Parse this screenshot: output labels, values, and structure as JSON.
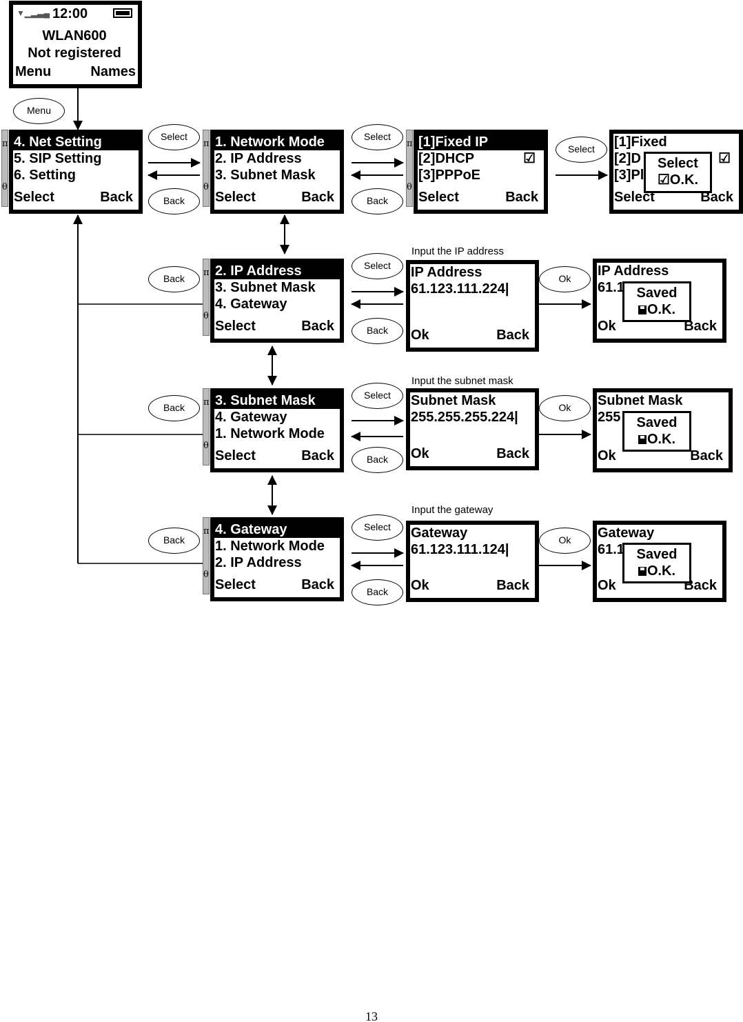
{
  "home_screen": {
    "time": "12:00",
    "lines": [
      "WLAN600",
      "Not registered"
    ],
    "softkeys": [
      "Menu",
      "Names"
    ],
    "icons": [
      "signal-icon",
      "battery-icon"
    ]
  },
  "screens": [
    {
      "id": "menu-net",
      "lines": [
        "4. Net Setting",
        "5. SIP Setting",
        "6. Setting"
      ],
      "highlight": true,
      "scrollbar": true,
      "softkeys": [
        "Select",
        "Back"
      ]
    },
    {
      "id": "net-network-mode",
      "lines": [
        "1. Network Mode",
        "2. IP Address",
        "3. Subnet Mask"
      ],
      "highlight": true,
      "scrollbar": true,
      "softkeys": [
        "Select",
        "Back"
      ]
    },
    {
      "id": "mode-list",
      "lines": [
        "[1]Fixed IP",
        "[2]DHCP",
        "[3]PPPoE"
      ],
      "highlight": true,
      "scrollbar": true,
      "check_line": 1,
      "softkeys": [
        "Select",
        "Back"
      ]
    },
    {
      "id": "mode-confirm",
      "lines": [
        "[1]Fixed",
        "[2]D",
        "[3]Pl"
      ],
      "highlight": false,
      "scrollbar": false,
      "check_line": 1,
      "softkeys": [
        "Select",
        "Back"
      ],
      "popup": {
        "title": "Select",
        "ok": "O.K.",
        "icon": "checkbox-icon"
      }
    },
    {
      "id": "net-ip-address",
      "lines": [
        "2. IP Address",
        "3. Subnet Mask",
        "4. Gateway"
      ],
      "highlight": true,
      "scrollbar": true,
      "softkeys": [
        "Select",
        "Back"
      ]
    },
    {
      "id": "ip-input",
      "lines": [
        "IP Address",
        "61.123.111.224|",
        "",
        ""
      ],
      "highlight": false,
      "scrollbar": false,
      "softkeys": [
        "Ok",
        "Back"
      ]
    },
    {
      "id": "ip-saved",
      "lines": [
        "IP Address",
        "61.1"
      ],
      "highlight": false,
      "scrollbar": false,
      "softkeys": [
        "Ok",
        "Back"
      ],
      "popup": {
        "title": "Saved",
        "ok": "O.K.",
        "icon": "floppy-disk-icon"
      }
    },
    {
      "id": "net-subnet-mask",
      "lines": [
        "3. Subnet Mask",
        "4. Gateway",
        "1. Network Mode"
      ],
      "highlight": true,
      "scrollbar": true,
      "softkeys": [
        "Select",
        "Back"
      ]
    },
    {
      "id": "subnet-input",
      "lines": [
        "Subnet Mask",
        "255.255.255.224|"
      ],
      "highlight": false,
      "scrollbar": false,
      "softkeys": [
        "Ok",
        "Back"
      ]
    },
    {
      "id": "subnet-saved",
      "lines": [
        "Subnet Mask",
        "255                  24"
      ],
      "highlight": false,
      "scrollbar": false,
      "softkeys": [
        "Ok",
        "Back"
      ],
      "popup": {
        "title": "Saved",
        "ok": "O.K.",
        "icon": "floppy-disk-icon"
      }
    },
    {
      "id": "net-gateway",
      "lines": [
        "4. Gateway",
        "1. Network Mode",
        "2. IP Address"
      ],
      "highlight": true,
      "scrollbar": true,
      "softkeys": [
        "Select",
        "Back"
      ]
    },
    {
      "id": "gateway-input",
      "lines": [
        "Gateway",
        "61.123.111.124|"
      ],
      "highlight": false,
      "scrollbar": false,
      "softkeys": [
        "Ok",
        "Back"
      ]
    },
    {
      "id": "gateway-saved",
      "lines": [
        "Gateway",
        "61.1"
      ],
      "highlight": false,
      "scrollbar": false,
      "softkeys": [
        "Ok",
        "Back"
      ],
      "popup": {
        "title": "Saved",
        "ok": "O.K.",
        "icon": "floppy-disk-icon"
      }
    }
  ],
  "scrollbar_symbols": [
    "π",
    "θ"
  ],
  "check_symbol": "☑",
  "buttons": [
    "Menu",
    "Select",
    "Back",
    "Select",
    "Back",
    "Select",
    "Back",
    "Select",
    "Back",
    "Ok",
    "Back",
    "Select",
    "Back",
    "Ok",
    "Back",
    "Select",
    "Back",
    "Ok"
  ],
  "captions": [
    "Input the IP address",
    "Input the subnet mask",
    "Input the gateway"
  ],
  "page_number": "13"
}
